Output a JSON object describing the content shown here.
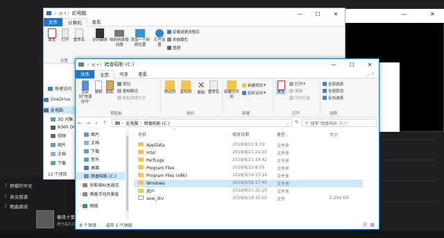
{
  "background": {
    "album_title": "春风十里",
    "album_artist": "鹿先森乐队",
    "sidebar": [
      "舒缓的中文",
      "英文摇滚",
      "歌曲调试"
    ]
  },
  "win_back": {
    "title": "此电脑",
    "tabs": [
      "文件",
      "计算机",
      "查看"
    ],
    "buttons": {
      "properties": "属性",
      "open": "打开",
      "rename": "重命名",
      "access_media": "访问媒体",
      "map_drive": "映射网络驱动器",
      "add_location": "添加一个网络位置",
      "open_settings": "打开设置"
    },
    "small": [
      "卸载或更改程序",
      "系统属性",
      "管理"
    ],
    "group_label": "位置",
    "nav": [
      "快速访问",
      "OneDrive",
      "此电脑",
      "3D 对象",
      "A360 Drive",
      "视频",
      "图片",
      "文档",
      "下载"
    ],
    "status": "12 个项目"
  },
  "win_front": {
    "title": "暗香昭影 (C:)",
    "tabs": {
      "file": "文件",
      "home": "主页",
      "share": "共享",
      "view": "查看"
    },
    "ribbon": {
      "pin": "固定到\"快速访问\"",
      "copy": "复制",
      "paste": "粘贴",
      "cut": "剪切",
      "copy_path": "复制路径",
      "paste_shortcut": "粘贴快捷方式",
      "move_to": "移动到",
      "copy_to": "复制到",
      "delete": "删除",
      "rename": "重命名",
      "new_folder": "新建文件夹",
      "new_item": "新建项目",
      "easy_access": "轻松访问",
      "properties": "属性",
      "open": "打开",
      "edit": "编辑",
      "history": "历史记录",
      "select_all": "全部选择",
      "select_none": "全部取消",
      "invert": "反向选择",
      "groups": [
        "剪贴板",
        "组织",
        "新建",
        "打开",
        "选择"
      ]
    },
    "address": {
      "path": [
        "此电脑",
        "暗香昭影 (C:)"
      ],
      "search_placeholder": "搜索\"暗香昭影 (C:)\""
    },
    "nav": [
      {
        "label": "图片",
        "color": "#5b9bd5"
      },
      {
        "label": "文档",
        "color": "#8faadc"
      },
      {
        "label": "下载",
        "color": "#4aa3df"
      },
      {
        "label": "音乐",
        "color": "#4aa3df"
      },
      {
        "label": "桌面",
        "color": "#3b7fd1"
      },
      {
        "label": "暗香昭影 (C:)",
        "color": "#888888"
      },
      {
        "label": "刹影绮纠水调沈",
        "color": "#888888"
      },
      {
        "label": "暗香浮动月黄昏",
        "color": "#888888"
      },
      {
        "label": "网络",
        "color": "#3b7fd1"
      }
    ],
    "columns": [
      "名称",
      "修改日期",
      "类型",
      "大小"
    ],
    "files": [
      {
        "name": "AppData",
        "date": "2018/8/22 9:19",
        "type": "文件夹",
        "size": ""
      },
      {
        "name": "Intel",
        "date": "2018/8/21 21:03",
        "type": "文件夹",
        "size": ""
      },
      {
        "name": "PerfLogs",
        "date": "2018/8/21 19:42",
        "type": "文件夹",
        "size": ""
      },
      {
        "name": "Program Files",
        "date": "2018/8/22 8:35",
        "type": "文件夹",
        "size": ""
      },
      {
        "name": "Program Files (x86)",
        "date": "2018/9/14 17:14",
        "type": "文件夹",
        "size": ""
      },
      {
        "name": "Windows",
        "date": "2018/9/18 17:40",
        "type": "文件夹",
        "size": ""
      },
      {
        "name": "用户",
        "date": "2018/8/21 22:20",
        "type": "文件夹",
        "size": ""
      },
      {
        "name": "aow_drv",
        "date": "2018/9/18 15:03",
        "type": "文件",
        "size": "2,250 KB"
      }
    ],
    "status": {
      "count": "8 个项目",
      "selected": "选中 1 个项目"
    }
  }
}
